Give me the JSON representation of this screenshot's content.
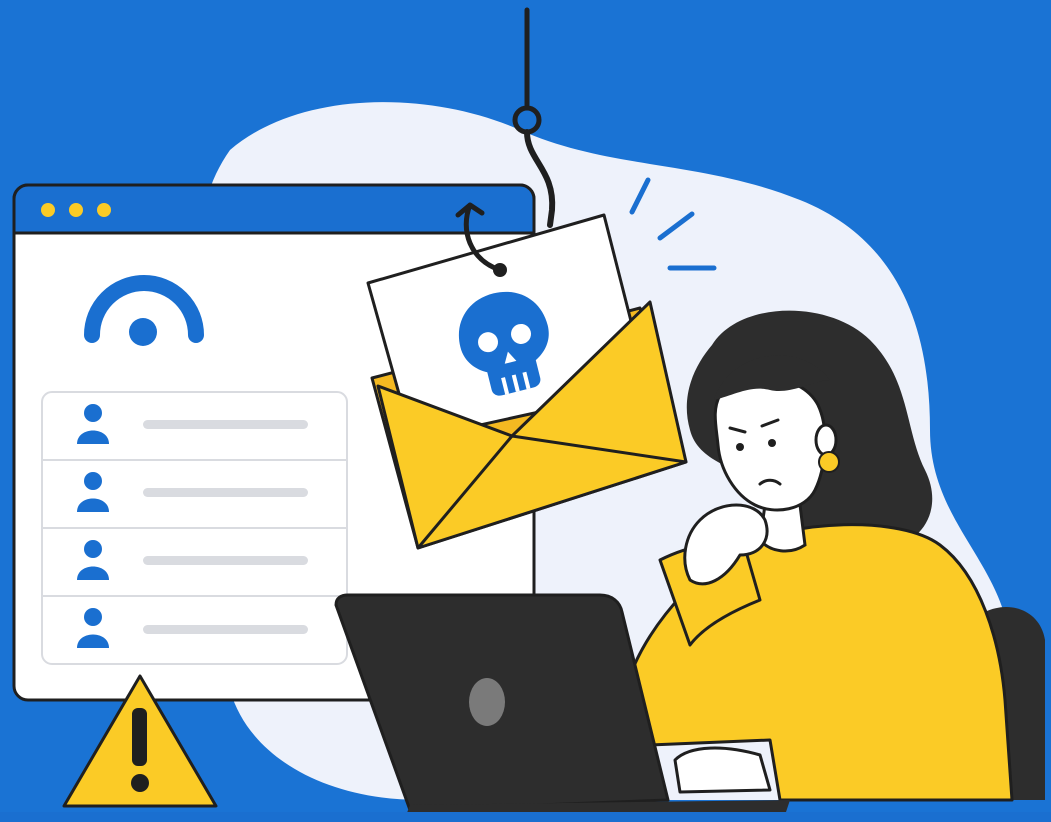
{
  "scene": {
    "subject": "phishing-email-illustration",
    "colors": {
      "background": "#1a73d4",
      "blob": "#eef2fb",
      "window": "#ffffff",
      "titlebar": "#1a6fd0",
      "accent_blue": "#1a6fd0",
      "yellow": "#fbcb26",
      "dark": "#2d2d2d",
      "outline": "#1f1f1f",
      "skin": "#ffffff",
      "gray_line": "#d9dbe0"
    },
    "window": {
      "titlebar_dots": [
        "#fbcb26",
        "#fbcb26",
        "#fbcb26"
      ],
      "logo_icon": "wifi-fingerprint-icon",
      "list_rows": [
        {
          "icon": "user-icon"
        },
        {
          "icon": "user-icon"
        },
        {
          "icon": "user-icon"
        },
        {
          "icon": "user-icon"
        }
      ]
    },
    "email": {
      "icon": "skull-icon",
      "envelope_color": "#fbcb26"
    },
    "hook": {
      "icon": "fishhook-icon"
    },
    "warning": {
      "icon": "warning-triangle-icon"
    },
    "person": {
      "sweater_color": "#fbcb26",
      "hair_color": "#2d2d2d"
    },
    "laptop": {
      "color": "#2d2d2d"
    }
  }
}
